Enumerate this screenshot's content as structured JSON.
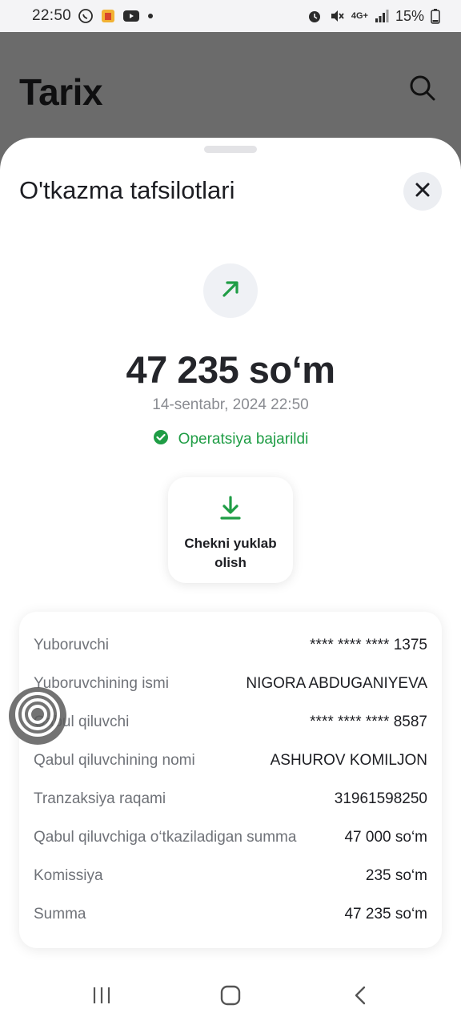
{
  "status_bar": {
    "time": "22:50",
    "battery": "15%",
    "network": "4G+",
    "icons_left": [
      "whatsapp-icon",
      "gallery-icon",
      "youtube-icon",
      "dot-icon"
    ],
    "icons_right": [
      "alarm-icon",
      "mute-icon",
      "data-arrows-icon",
      "signal-icon",
      "battery-icon"
    ]
  },
  "background_page": {
    "title": "Tarix",
    "search_icon": "search-icon"
  },
  "sheet": {
    "title": "O'tkazma tafsilotlari",
    "close_icon": "close-icon",
    "direction_icon": "arrow-up-right-icon",
    "amount": "47 235 so‘m",
    "date": "14-sentabr, 2024 22:50",
    "status": "Operatsiya bajarildi",
    "download_button": {
      "label": "Chekni yuklab olish",
      "icon": "download-icon"
    },
    "details": [
      {
        "label": "Yuboruvchi",
        "value": "**** **** **** 1375"
      },
      {
        "label": "Yuboruvchining ismi",
        "value": "NIGORA ABDUGANIYEVA"
      },
      {
        "label": "Qabul qiluvchi",
        "value": "**** **** **** 8587"
      },
      {
        "label": "Qabul qiluvchining nomi",
        "value": "ASHUROV KOMILJON"
      },
      {
        "label": "Tranzaksiya raqami",
        "value": "31961598250"
      },
      {
        "label": "Qabul qiluvchiga o‘tkaziladigan summa",
        "value": "47 000 so‘m"
      },
      {
        "label": "Komissiya",
        "value": "235 so‘m"
      },
      {
        "label": "Summa",
        "value": "47 235 so‘m"
      }
    ]
  },
  "colors": {
    "success_green": "#1f9d45",
    "overlay_gray": "#6b6b6b",
    "text_primary": "#1c1d22",
    "text_secondary": "#6f7278"
  },
  "nav_bar": {
    "items": [
      "recents-icon",
      "home-icon",
      "back-icon"
    ]
  }
}
